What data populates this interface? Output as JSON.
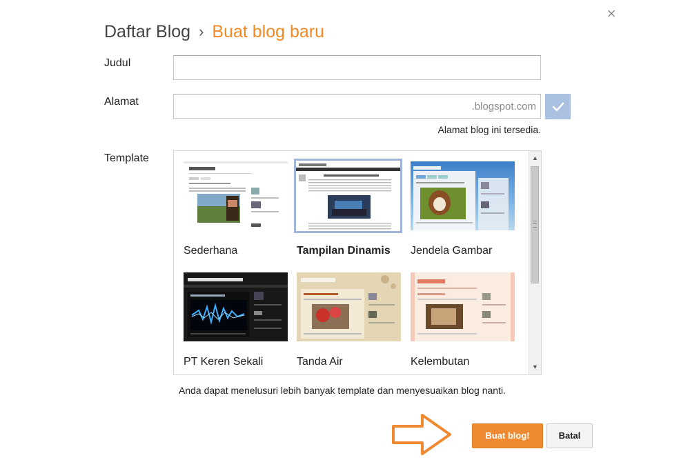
{
  "dialog": {
    "close_icon": "×",
    "breadcrumb": {
      "parent": "Daftar Blog",
      "separator": "›",
      "current": "Buat blog baru"
    }
  },
  "form": {
    "title_label": "Judul",
    "title_value": "",
    "address_label": "Alamat",
    "address_value": "",
    "address_suffix": ".blogspot.com",
    "address_status": "Alamat blog ini tersedia.",
    "template_label": "Template"
  },
  "templates": [
    {
      "name": "Sederhana",
      "selected": false
    },
    {
      "name": "Tampilan Dinamis",
      "selected": true
    },
    {
      "name": "Jendela Gambar",
      "selected": false
    },
    {
      "name": "PT Keren Sekali",
      "selected": false
    },
    {
      "name": "Tanda Air",
      "selected": false
    },
    {
      "name": "Kelembutan",
      "selected": false
    }
  ],
  "template_hint": "Anda dapat menelusuri lebih banyak template dan menyesuaikan blog nanti.",
  "actions": {
    "create_label": "Buat blog!",
    "cancel_label": "Batal"
  },
  "colors": {
    "accent": "#f08a24",
    "check_bg": "#a9c0e1",
    "selected_border": "#9fb4d6"
  }
}
